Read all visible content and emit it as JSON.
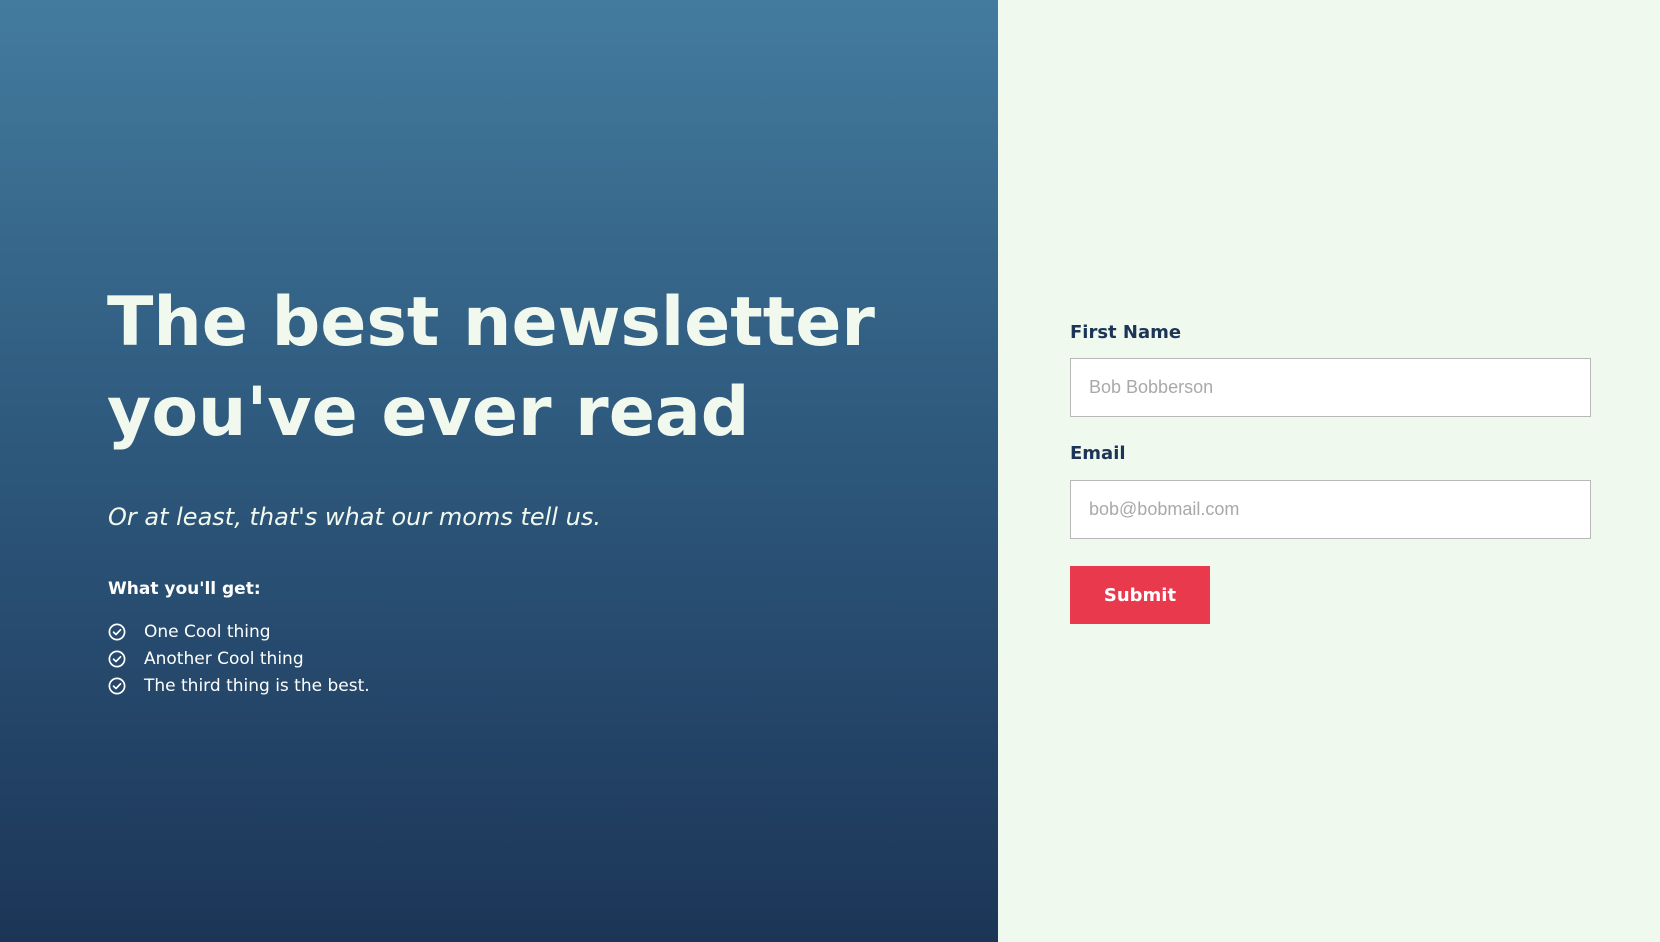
{
  "hero": {
    "title": "The best newsletter you've ever read",
    "subtitle": "Or at least, that's what our moms tell us.",
    "benefits_heading": "What you'll get:",
    "benefits": [
      {
        "label": "One Cool thing",
        "icon": "check-circle-icon"
      },
      {
        "label": "Another Cool thing",
        "icon": "check-circle-icon"
      },
      {
        "label": "The third thing is the best.",
        "icon": "check-circle-icon"
      }
    ]
  },
  "form": {
    "first_name": {
      "label": "First Name",
      "placeholder": "Bob Bobberson",
      "value": ""
    },
    "email": {
      "label": "Email",
      "placeholder": "bob@bobmail.com",
      "value": ""
    },
    "submit_label": "Submit"
  },
  "colors": {
    "hero_gradient_top": "#437b9e",
    "hero_gradient_bottom": "#1c3557",
    "hero_text": "#f1f9ef",
    "form_background": "#f0f9ee",
    "label_text": "#1c3557",
    "submit_button": "#e8394d"
  }
}
